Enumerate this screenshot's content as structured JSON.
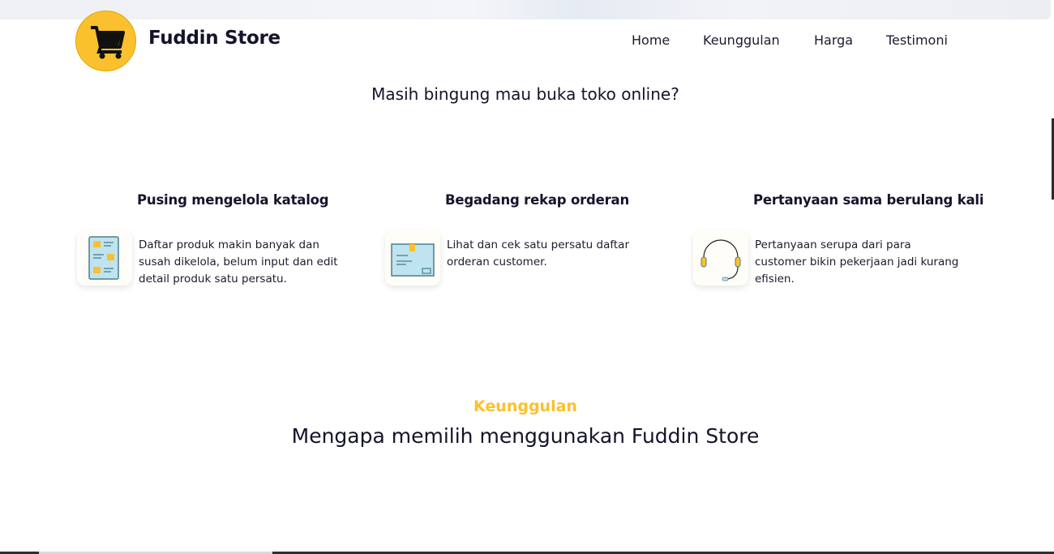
{
  "brand": {
    "name": "Fuddin Store"
  },
  "nav": {
    "items": [
      "Home",
      "Keunggulan",
      "Harga",
      "Testimoni"
    ]
  },
  "hero": {
    "question": "Masih bingung mau buka toko online?"
  },
  "pains": [
    {
      "title": "Pusing mengelola katalog",
      "lines": [
        "Daftar produk makin banyak dan",
        "susah dikelola, belum input dan edit",
        "detail produk satu persatu."
      ],
      "icon": "catalog-icon"
    },
    {
      "title": "Begadang rekap orderan",
      "lines": [
        "Lihat dan cek satu persatu daftar",
        "orderan customer."
      ],
      "icon": "order-box-icon"
    },
    {
      "title": "Pertanyaan sama berulang kali",
      "lines": [
        "Pertanyaan serupa dari para",
        "customer bikin pekerjaan jadi kurang",
        "efisien."
      ],
      "icon": "headset-icon"
    }
  ],
  "advantages": {
    "tag": "Keunggulan",
    "title": "Mengapa memilih menggunakan Fuddin Store"
  },
  "colors": {
    "accent": "#fbc02d",
    "text": "#14142b"
  }
}
